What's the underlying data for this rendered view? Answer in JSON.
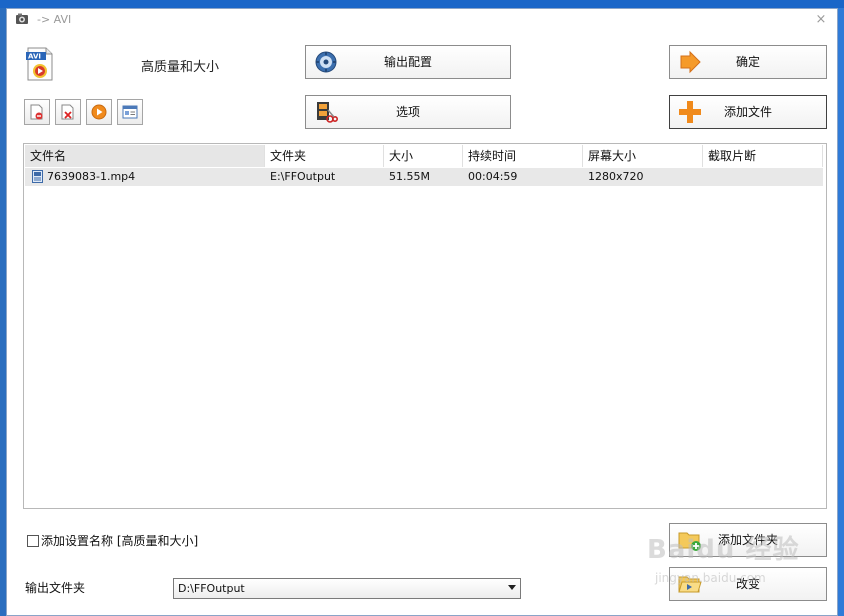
{
  "window": {
    "title": "-> AVI",
    "close_glyph": "×"
  },
  "profile": {
    "icon": "avi-file-icon",
    "label": "高质量和大小"
  },
  "buttons": {
    "output_config": {
      "label": "输出配置",
      "icon": "gear-disc-icon"
    },
    "options": {
      "label": "选项",
      "icon": "film-scissors-icon"
    },
    "ok": {
      "label": "确定",
      "icon": "arrow-right-icon"
    },
    "add_file": {
      "label": "添加文件",
      "icon": "plus-icon"
    },
    "add_folder": {
      "label": "添加文件夹",
      "icon": "folder-add-icon"
    },
    "change": {
      "label": "改变",
      "icon": "folder-open-icon"
    }
  },
  "toolbar": [
    {
      "name": "remove-file-button",
      "icon": "file-remove-icon"
    },
    {
      "name": "clear-list-button",
      "icon": "file-delete-icon"
    },
    {
      "name": "play-button",
      "icon": "play-icon"
    },
    {
      "name": "media-info-button",
      "icon": "info-window-icon"
    }
  ],
  "file_list": {
    "columns": [
      "文件名",
      "文件夹",
      "大小",
      "持续时间",
      "屏幕大小",
      "截取片断"
    ],
    "rows": [
      {
        "name": "7639083-1.mp4",
        "folder": "E:\\FFOutput",
        "size": "51.55M",
        "duration": "00:04:59",
        "resolution": "1280x720",
        "clip": ""
      }
    ]
  },
  "append_setting": {
    "checked": false,
    "label": "添加设置名称 [高质量和大小]"
  },
  "output_folder": {
    "label": "输出文件夹",
    "value": "D:\\FFOutput"
  },
  "watermark": {
    "text": "Baidu 经验",
    "sub": "jingyan.baidu.com"
  },
  "colors": {
    "accent_orange": "#f08a1c",
    "window_bg": "#ffffff",
    "desktop": "#1e6fd0"
  }
}
